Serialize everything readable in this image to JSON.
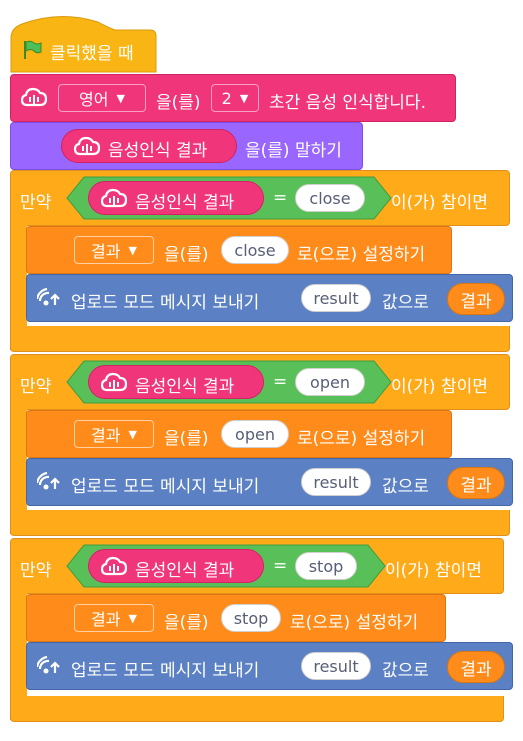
{
  "hat": {
    "label": "클릭했을 때"
  },
  "recognize": {
    "language": "영어",
    "prep": "을(를)",
    "seconds": "2",
    "suffix": "초간 음성 인식합니다."
  },
  "speak": {
    "reporter": "음성인식 결과",
    "suffix": "을(를) 말하기"
  },
  "if_blocks": [
    {
      "prefix": "만약",
      "reporter": "음성인식 결과",
      "equals": "=",
      "compare": "close",
      "suffix": "이(가) 참이면",
      "set": {
        "variable": "결과",
        "prep": "을(를)",
        "value": "close",
        "suffix": "로(으로) 설정하기"
      },
      "upload": {
        "label": "업로드 모드 메시지 보내기",
        "key": "result",
        "mid": "값으로",
        "value": "결과"
      }
    },
    {
      "prefix": "만약",
      "reporter": "음성인식 결과",
      "equals": "=",
      "compare": "open",
      "suffix": "이(가) 참이면",
      "set": {
        "variable": "결과",
        "prep": "을(를)",
        "value": "open",
        "suffix": "로(으로) 설정하기"
      },
      "upload": {
        "label": "업로드 모드 메시지 보내기",
        "key": "result",
        "mid": "값으로",
        "value": "결과"
      }
    },
    {
      "prefix": "만약",
      "reporter": "음성인식 결과",
      "equals": "=",
      "compare": "stop",
      "suffix": "이(가) 참이면",
      "set": {
        "variable": "결과",
        "prep": "을(를)",
        "value": "stop",
        "suffix": "로(으로) 설정하기"
      },
      "upload": {
        "label": "업로드 모드 메시지 보내기",
        "key": "result",
        "mid": "값으로",
        "value": "결과"
      }
    }
  ],
  "colors": {
    "hat": "#f9b513",
    "speech": "#f0357a",
    "looks": "#9966ff",
    "control": "#ffab19",
    "variables": "#ff8c1a",
    "upload": "#5b80c4",
    "operator": "#59c059"
  },
  "icons": {
    "flag": "green-flag-icon",
    "cloud": "cloud-speech-icon",
    "upload": "upload-signal-icon",
    "dropdown": "caret-down-icon"
  }
}
